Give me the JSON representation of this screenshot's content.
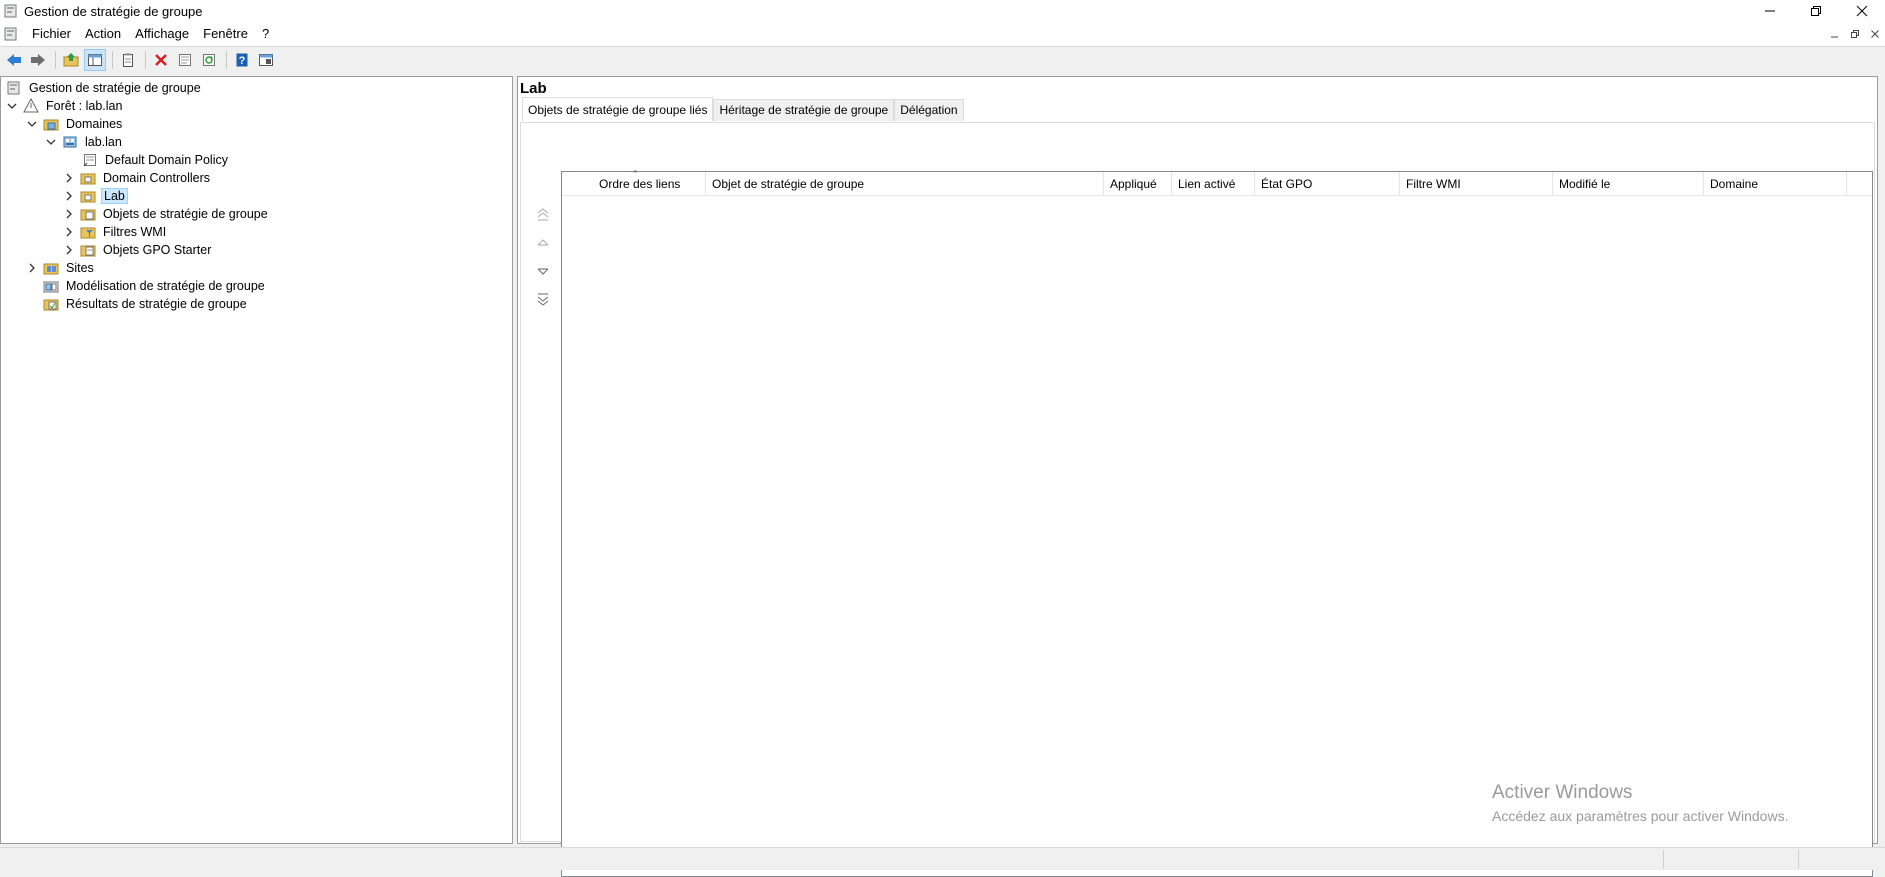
{
  "window": {
    "title": "Gestion de stratégie de groupe"
  },
  "menu": [
    "Fichier",
    "Action",
    "Affichage",
    "Fenêtre",
    "?"
  ],
  "toolbar": {
    "icons": [
      "back-arrow-icon",
      "forward-arrow-icon",
      "up-folder-icon",
      "show-hide-tree-icon",
      "export-list-icon",
      "delete-icon",
      "properties-icon",
      "refresh-icon",
      "help-icon",
      "mmc-icon"
    ]
  },
  "tree": {
    "root": "Gestion de stratégie de groupe",
    "forest": "Forêt : lab.lan",
    "domains": "Domaines",
    "domain": "lab.lan",
    "default_policy": "Default Domain Policy",
    "dc": "Domain Controllers",
    "lab": "Lab",
    "gpo_objects": "Objets de stratégie de groupe",
    "wmi": "Filtres WMI",
    "starter": "Objets GPO Starter",
    "sites": "Sites",
    "modeling": "Modélisation de stratégie de groupe",
    "results": "Résultats de stratégie de groupe"
  },
  "details": {
    "title": "Lab",
    "tabs": [
      "Objets de stratégie de groupe liés",
      "Héritage de stratégie de groupe",
      "Délégation"
    ],
    "columns": [
      "Ordre des liens",
      "Objet de stratégie de groupe",
      "Appliqué",
      "Lien activé",
      "État GPO",
      "Filtre WMI",
      "Modifié le",
      "Domaine"
    ],
    "rows": []
  },
  "watermark": {
    "line1": "Activer Windows",
    "line2": "Accédez aux paramètres pour activer Windows."
  },
  "colors": {
    "selection": "#cce8ff",
    "accent": "#0078d7"
  }
}
